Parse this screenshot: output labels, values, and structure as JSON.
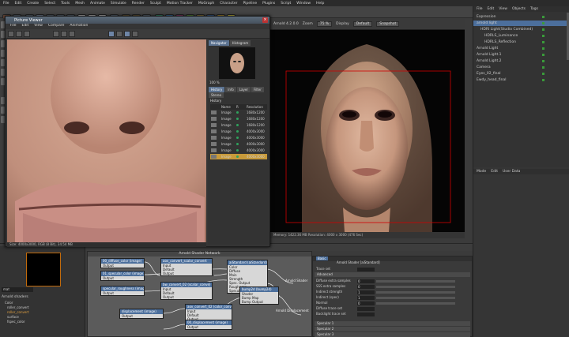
{
  "menubar": {
    "items": [
      "File",
      "Edit",
      "Create",
      "Select",
      "Tools",
      "Mesh",
      "Animate",
      "Simulate",
      "Render",
      "Sculpt",
      "Motion Tracker",
      "MoGraph",
      "Character",
      "Pipeline",
      "Plugins",
      "Script",
      "Window",
      "Help"
    ],
    "layout_label": "Layout:",
    "layout_value": "Startup (User)"
  },
  "toolbar": {
    "x": "X",
    "y": "Y",
    "z": "Z"
  },
  "picture_viewer": {
    "title": "Picture Viewer",
    "menus": [
      "File",
      "Edit",
      "View",
      "Compare",
      "Animation"
    ],
    "status": "Size: 4000x3000, RGB (8 Bit), 34.54 MB",
    "zoom": "100 %",
    "tabs": [
      "Navigator",
      "Histogram"
    ],
    "sub_tabs": [
      "History",
      "Info",
      "Layer",
      "Filter"
    ],
    "sub_tab2": "Stereo",
    "history_title": "History",
    "history_headers": [
      "Name",
      "R",
      "Resolution"
    ],
    "history": [
      {
        "name": "Image",
        "res": "1680x1200"
      },
      {
        "name": "Image",
        "res": "1680x1200"
      },
      {
        "name": "Image",
        "res": "1680x1200"
      },
      {
        "name": "Image",
        "res": "4000x3000"
      },
      {
        "name": "Image",
        "res": "4000x3000"
      },
      {
        "name": "Image",
        "res": "4000x3000"
      },
      {
        "name": "Image",
        "res": "4000x3000"
      },
      {
        "name": "Image",
        "res": "4000x3000"
      }
    ]
  },
  "viewport": {
    "title": "Perspective",
    "camera": "Camera",
    "display_label": "Display",
    "display_value": "Default",
    "snap_label": "Snapshot",
    "zoom_label": "Zoom",
    "zoom_value": "75 %",
    "status": "Memory: 1422.36 MB  Resolution: 4000 x 3000  (476 Sec)",
    "render_info": "Arnold 4.2.0.0"
  },
  "object_manager": {
    "menus": [
      "File",
      "Edit",
      "View",
      "Objects",
      "Tags"
    ],
    "objects": [
      {
        "name": "Expression",
        "indent": 0
      },
      {
        "name": "arnold light",
        "indent": 0
      },
      {
        "name": "HDRI Light(Studio Combined)",
        "indent": 1
      },
      {
        "name": "HDRLS_Luminance",
        "indent": 2
      },
      {
        "name": "HDRLS_Reflection",
        "indent": 2
      },
      {
        "name": "Arnold Light",
        "indent": 0
      },
      {
        "name": "Arnold Light.1",
        "indent": 0
      },
      {
        "name": "Arnold Light.2",
        "indent": 0
      },
      {
        "name": "Camera",
        "indent": 0
      },
      {
        "name": "Eyes_02_final",
        "indent": 0
      },
      {
        "name": "Ewdy_head_final",
        "indent": 0
      }
    ]
  },
  "attribute_manager": {
    "menus": [
      "Mode",
      "Edit",
      "User Data"
    ]
  },
  "shader_network": {
    "title": "Arnold Shader Network",
    "nodes": [
      {
        "title": "00_diffuse_color (image)",
        "lines": [
          "Output"
        ]
      },
      {
        "title": "01_specular_color (image)",
        "lines": [
          "Output"
        ]
      },
      {
        "title": "specular_roughness (image)",
        "lines": [
          "Output"
        ]
      },
      {
        "title": "aov_convert_scalar_convert",
        "lines": [
          "Input",
          "Default",
          "Output"
        ]
      },
      {
        "title": "aiStandard (aiStandard)",
        "lines": [
          "Color",
          "Diffuse",
          "Main",
          "Strength",
          "Spec. Output",
          "Roughness",
          "Specular 1"
        ]
      },
      {
        "title": "bw_convert_02 (scalar_conve)",
        "lines": [
          "Input",
          "Default",
          "Output"
        ]
      },
      {
        "title": "displacement (image)",
        "lines": [
          "Output"
        ]
      },
      {
        "title": "aov_convert_02 (color_conve)",
        "lines": [
          "Input",
          "Default",
          "Output"
        ]
      },
      {
        "title": "bump2d (bump2d)",
        "lines": [
          "Shader",
          "Bump Map",
          "Bump Output"
        ]
      },
      {
        "title": "00_displacement (image)",
        "lines": [
          "Output"
        ]
      }
    ],
    "port_labels": [
      "Arnold Shader",
      "Arnold Displacement"
    ]
  },
  "attr_panel": {
    "title": "Arnold Shader [aiStandard]",
    "tab": "Basic",
    "trace_label": "Trace set",
    "section": "Advanced",
    "rows": [
      {
        "label": "Diffuse extra samples",
        "value": "0"
      },
      {
        "label": "SSS extra samples",
        "value": "0"
      },
      {
        "label": "Indirect strength",
        "value": "1"
      },
      {
        "label": "Indirect (spec)",
        "value": "1"
      },
      {
        "label": "Normal",
        "value": "0"
      },
      {
        "label": "Diffuse trace set",
        "value": ""
      },
      {
        "label": "Backlight trace set",
        "value": ""
      }
    ],
    "sub_sections": [
      "Specular 1",
      "Specular 2",
      "Specular 3"
    ]
  },
  "material_panel": {
    "search": "mat",
    "tree_title": "Arnold shaders",
    "tree": [
      "Color",
      "roller_convert",
      "roller_convert",
      "surface",
      "fspec_color"
    ]
  },
  "colors": {
    "accent": "#c26a0a",
    "node_header": "#4c6f9c",
    "selection": "#c89a3a",
    "render_frame": "#d10000"
  }
}
